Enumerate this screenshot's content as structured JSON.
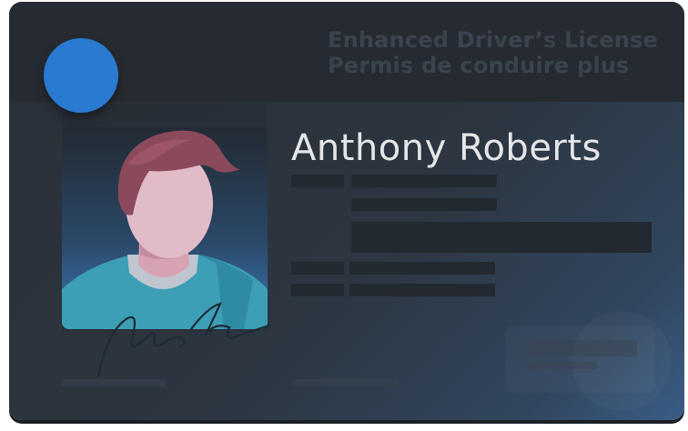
{
  "card": {
    "header_line1": "Enhanced Driver’s License",
    "header_line2": "Permis de conduire plus",
    "holder_name": "Anthony Roberts"
  },
  "colors": {
    "seal": "#2a7ad1",
    "header_text": "#3a434e",
    "name_text": "#e6e6e8",
    "card_dark": "#2a3038",
    "card_blue_corner": "#3a5d86"
  },
  "icons": {
    "seal": "round-blue-seal",
    "portrait": "person-avatar",
    "signature": "handwritten-signature"
  }
}
